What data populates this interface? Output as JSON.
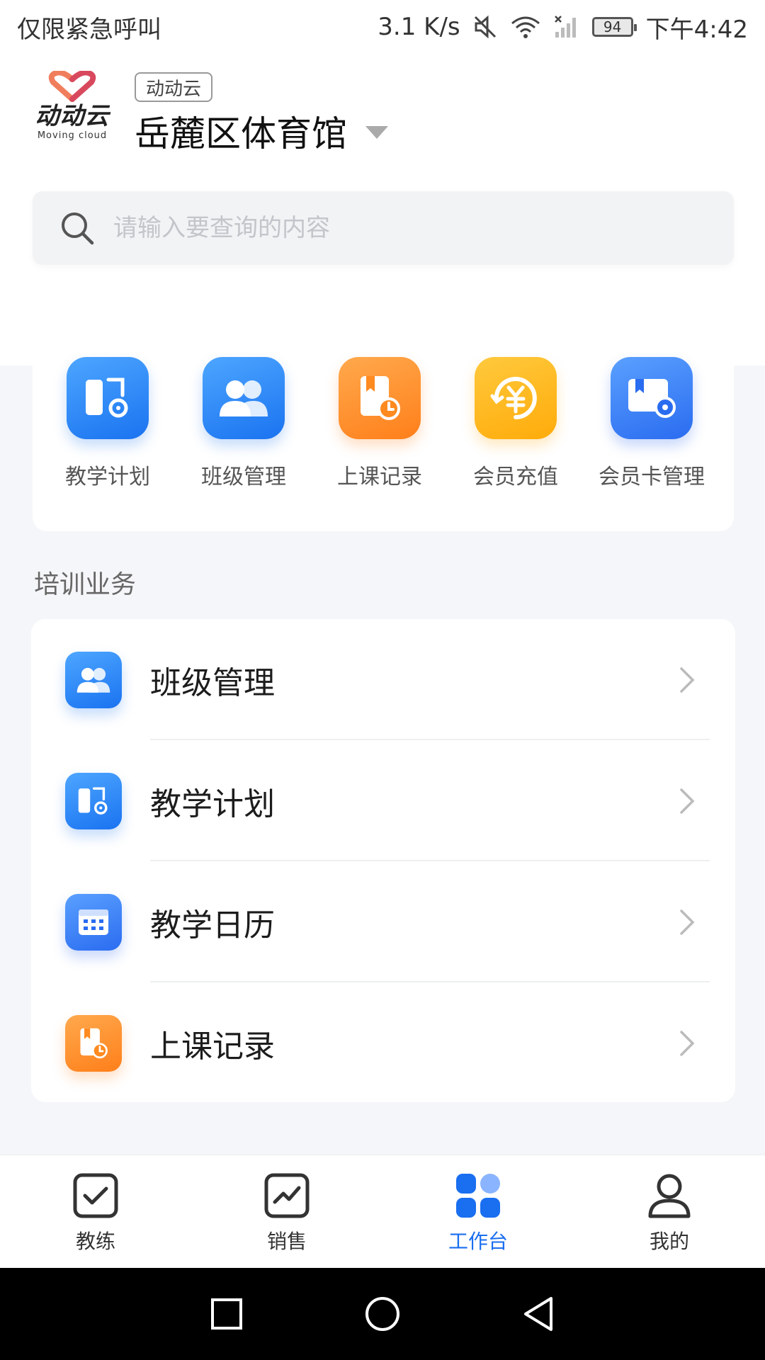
{
  "status_bar": {
    "left_text": "仅限紧急呼叫",
    "net_speed": "3.1 K/s",
    "battery": "94",
    "time": "下午4:42",
    "icons": [
      "mute-icon",
      "wifi-icon",
      "signal-icon",
      "battery-icon"
    ]
  },
  "header": {
    "logo_text": "动动云",
    "logo_sub": "Moving cloud",
    "tag": "动动云",
    "venue": "岳麓区体育馆"
  },
  "search": {
    "placeholder": "请输入要查询的内容",
    "value": ""
  },
  "quick_actions": [
    {
      "label": "教学计划",
      "icon": "plan-icon"
    },
    {
      "label": "班级管理",
      "icon": "class-icon"
    },
    {
      "label": "上课记录",
      "icon": "record-icon"
    },
    {
      "label": "会员充值",
      "icon": "recharge-icon"
    },
    {
      "label": "会员卡管理",
      "icon": "card-icon"
    }
  ],
  "section": {
    "title": "培训业务"
  },
  "list_items": [
    {
      "label": "班级管理",
      "icon": "class-icon"
    },
    {
      "label": "教学计划",
      "icon": "plan-icon"
    },
    {
      "label": "教学日历",
      "icon": "calendar-icon"
    },
    {
      "label": "上课记录",
      "icon": "record-icon"
    }
  ],
  "tabs": [
    {
      "label": "教练",
      "icon": "check-square-icon",
      "active": false
    },
    {
      "label": "销售",
      "icon": "chart-square-icon",
      "active": false
    },
    {
      "label": "工作台",
      "icon": "grid-icon",
      "active": true
    },
    {
      "label": "我的",
      "icon": "user-icon",
      "active": false
    }
  ],
  "colors": {
    "accent": "#1a6ef0",
    "orange": "#ff8a1f",
    "yellow": "#ffb31a"
  }
}
